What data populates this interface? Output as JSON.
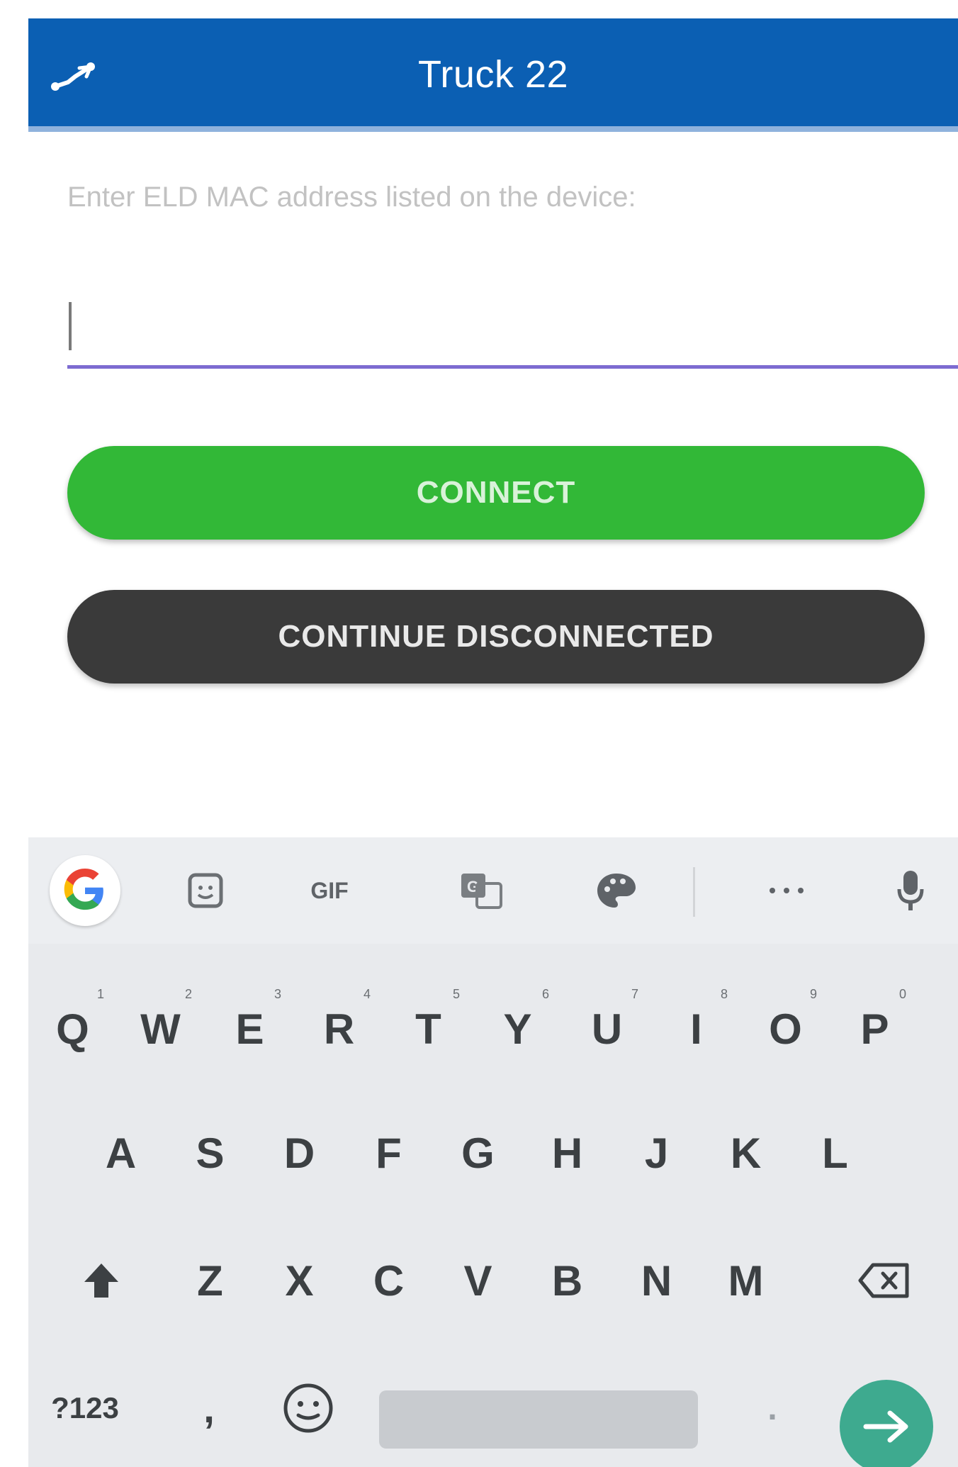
{
  "app_bar": {
    "title": "Truck 22",
    "icon": "bluetooth-connect-icon"
  },
  "form": {
    "instruction": "Enter ELD MAC address listed on the device:",
    "mac_input": {
      "value": "",
      "placeholder": ""
    }
  },
  "buttons": {
    "connect": "CONNECT",
    "continue_disconnected": "CONTINUE DISCONNECTED"
  },
  "colors": {
    "app_bar": "#0b5fb3",
    "connect": "#32b837",
    "continue_disconnected": "#3a3a3a",
    "input_underline": "#7d6bd1",
    "enter_key": "#3eaa8f"
  },
  "keyboard": {
    "suggestion_bar": {
      "gif_label": "GIF",
      "icons": [
        "google-icon",
        "sticker-icon",
        "gif-icon",
        "translate-icon",
        "palette-icon",
        "more-icon",
        "mic-icon"
      ]
    },
    "row1": [
      {
        "key": "Q",
        "hint": "1"
      },
      {
        "key": "W",
        "hint": "2"
      },
      {
        "key": "E",
        "hint": "3"
      },
      {
        "key": "R",
        "hint": "4"
      },
      {
        "key": "T",
        "hint": "5"
      },
      {
        "key": "Y",
        "hint": "6"
      },
      {
        "key": "U",
        "hint": "7"
      },
      {
        "key": "I",
        "hint": "8"
      },
      {
        "key": "O",
        "hint": "9"
      },
      {
        "key": "P",
        "hint": "0"
      }
    ],
    "row2": [
      "A",
      "S",
      "D",
      "F",
      "G",
      "H",
      "J",
      "K",
      "L"
    ],
    "row3": [
      "Z",
      "X",
      "C",
      "V",
      "B",
      "N",
      "M"
    ],
    "row4": {
      "symbols": "?123",
      "comma": ",",
      "period": "."
    }
  }
}
